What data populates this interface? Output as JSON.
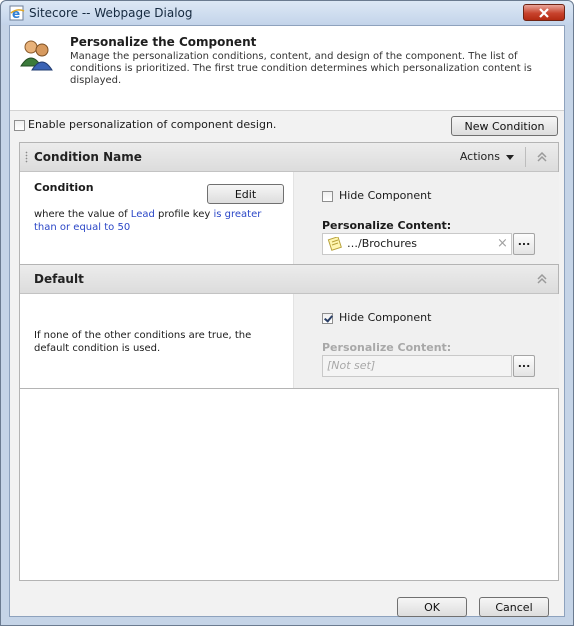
{
  "window": {
    "title": "Sitecore -- Webpage Dialog"
  },
  "header": {
    "title": "Personalize the Component",
    "description": "Manage the personalization conditions, content, and design of the component. The list of conditions is prioritized. The first true condition determines which personalization content is displayed."
  },
  "toolbar": {
    "enable_design_label": "Enable personalization of component design.",
    "enable_design_checked": false,
    "new_condition_label": "New Condition"
  },
  "condition_panel": {
    "title": "Condition Name",
    "actions_label": "Actions",
    "condition_heading": "Condition",
    "edit_label": "Edit",
    "rule_prefix": "where the value of ",
    "rule_key_link": "Lead",
    "rule_middle": " profile key ",
    "rule_op_link": "is greater than or equal to",
    "rule_space": " ",
    "rule_value_link": "50",
    "hide_component_label": "Hide Component",
    "hide_component_checked": false,
    "personalize_content_label": "Personalize Content:",
    "content_value": "…/Brochures",
    "clear_symbol": "×",
    "browse_label": "..."
  },
  "default_panel": {
    "title": "Default",
    "description": "If none of the other conditions are true, the default condition is used.",
    "hide_component_label": "Hide Component",
    "hide_component_checked": true,
    "personalize_content_label": "Personalize Content:",
    "content_value": "[Not set]",
    "browse_label": "..."
  },
  "footer": {
    "ok_label": "OK",
    "cancel_label": "Cancel"
  },
  "colors": {
    "link": "#2b47c7",
    "close_button": "#c8432d",
    "titlebar": "#c3d4ea"
  },
  "icons": {
    "title": "ie-page-icon",
    "header": "users-icon",
    "collapse": "double-chevron-up-icon",
    "content_item": "document-icon"
  }
}
